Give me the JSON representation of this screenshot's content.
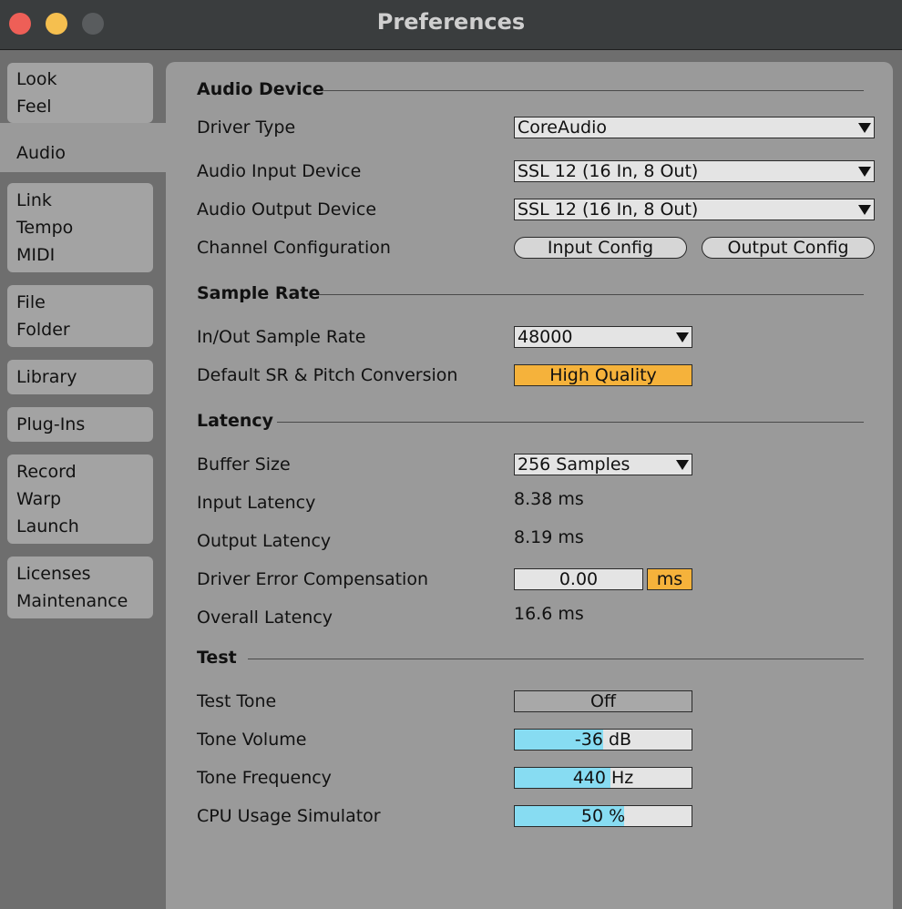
{
  "window": {
    "title": "Preferences"
  },
  "sidebar": {
    "groups": [
      [
        "Look",
        "Feel"
      ],
      [
        "Audio"
      ],
      [
        "Link",
        "Tempo",
        "MIDI"
      ],
      [
        "File",
        "Folder"
      ],
      [
        "Library"
      ],
      [
        "Plug-Ins"
      ],
      [
        "Record",
        "Warp",
        "Launch"
      ],
      [
        "Licenses",
        "Maintenance"
      ]
    ],
    "active": "Audio"
  },
  "audio_device": {
    "title": "Audio Device",
    "driver_type_label": "Driver Type",
    "driver_type_value": "CoreAudio",
    "input_device_label": "Audio Input Device",
    "input_device_value": "SSL 12 (16 In, 8 Out)",
    "output_device_label": "Audio Output Device",
    "output_device_value": "SSL 12 (16 In, 8 Out)",
    "channel_config_label": "Channel Configuration",
    "input_config_button": "Input Config",
    "output_config_button": "Output Config"
  },
  "sample_rate": {
    "title": "Sample Rate",
    "rate_label": "In/Out Sample Rate",
    "rate_value": "48000",
    "conversion_label": "Default SR & Pitch Conversion",
    "conversion_value": "High Quality"
  },
  "latency": {
    "title": "Latency",
    "buffer_label": "Buffer Size",
    "buffer_value": "256 Samples",
    "input_latency_label": "Input Latency",
    "input_latency_value": "8.38 ms",
    "output_latency_label": "Output Latency",
    "output_latency_value": "8.19 ms",
    "driver_comp_label": "Driver Error Compensation",
    "driver_comp_value": "0.00",
    "driver_comp_unit": "ms",
    "overall_label": "Overall Latency",
    "overall_value": "16.6 ms"
  },
  "test": {
    "title": "Test",
    "tone_label": "Test Tone",
    "tone_value": "Off",
    "volume_label": "Tone Volume",
    "volume_value": "-36 dB",
    "volume_fill": 0.5,
    "frequency_label": "Tone Frequency",
    "frequency_value": "440 Hz",
    "frequency_fill": 0.54,
    "cpu_label": "CPU Usage Simulator",
    "cpu_value": "50 %",
    "cpu_fill": 0.62
  },
  "colors": {
    "accent_orange": "#f5b23b",
    "slider_blue": "#87dcf2"
  }
}
